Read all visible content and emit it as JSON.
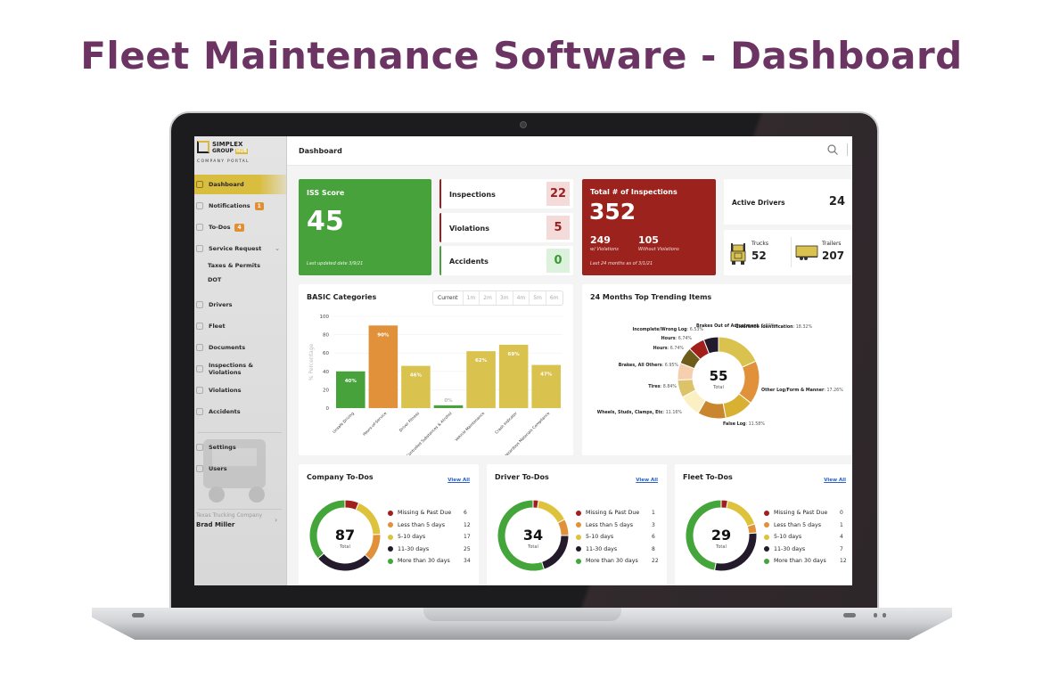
{
  "headline": "Fleet Maintenance Software - Dashboard",
  "sidebar": {
    "logo": {
      "line1": "SIMPLEX",
      "line2": "GROUP",
      "line2_tag": "HUB",
      "subtitle": "COMPANY PORTAL"
    },
    "items": [
      {
        "label": "Dashboard",
        "icon": "grid-icon",
        "active": true
      },
      {
        "label": "Notifications",
        "icon": "megaphone-icon",
        "badge": "1"
      },
      {
        "label": "To-Dos",
        "icon": "clipboard-icon",
        "badge": "4"
      },
      {
        "label": "Service Request",
        "icon": "briefcase-icon",
        "expandable": true
      },
      {
        "label": "Taxes & Permits",
        "sub": true
      },
      {
        "label": "DOT",
        "sub": true
      },
      {
        "label": "Drivers",
        "icon": "user-circle-icon"
      },
      {
        "label": "Fleet",
        "icon": "truck-icon"
      },
      {
        "label": "Documents",
        "icon": "document-icon"
      },
      {
        "label": "Inspections & Violations",
        "icon": "document-icon"
      },
      {
        "label": "Violations",
        "icon": "document-icon"
      },
      {
        "label": "Accidents",
        "icon": "document-icon"
      },
      {
        "label": "Settings",
        "icon": "gear-icon"
      },
      {
        "label": "Users",
        "icon": "users-icon"
      }
    ],
    "company": "Texas Trucking Company",
    "user": "Brad Miller"
  },
  "header": {
    "title": "Dashboard"
  },
  "iss": {
    "label": "ISS Score",
    "value": "45",
    "updated": "Last updated date 3/9/21",
    "color": "#48a23c"
  },
  "stats": [
    {
      "label": "Inspections",
      "value": "22",
      "status": "bad"
    },
    {
      "label": "Violations",
      "value": "5",
      "status": "bad"
    },
    {
      "label": "Accidents",
      "value": "0",
      "status": "good"
    }
  ],
  "total_inspections": {
    "label": "Total # of Inspections",
    "value": "352",
    "with_violations": "249",
    "with_violations_label": "w/ Violations",
    "without_violations": "105",
    "without_violations_label": "Without Violations",
    "period": "Last 24 months as of 3/1/21",
    "color": "#9c231d"
  },
  "active_drivers": {
    "label": "Active Drivers",
    "value": "24"
  },
  "vehicles": {
    "trucks_label": "Trucks",
    "trucks": "52",
    "trailers_label": "Trailers",
    "trailers": "207"
  },
  "basic": {
    "title": "BASIC Categories",
    "ranges": [
      "Current",
      "1m",
      "2m",
      "3m",
      "4m",
      "5m",
      "6m"
    ],
    "selected_range": "Current"
  },
  "trend": {
    "title": "24 Months Top Trending Items"
  },
  "todos": [
    {
      "title": "Company To-Dos",
      "view_all": "View All",
      "total": "87",
      "total_label": "Total",
      "items": [
        {
          "label": "Missing & Past Due",
          "count": 6
        },
        {
          "label": "Less than 5 days",
          "count": 12
        },
        {
          "label": "5-10 days",
          "count": 17
        },
        {
          "label": "11-30 days",
          "count": 25
        },
        {
          "label": "More than 30 days",
          "count": 34
        }
      ]
    },
    {
      "title": "Driver To-Dos",
      "view_all": "View All",
      "total": "34",
      "total_label": "Total",
      "items": [
        {
          "label": "Missing & Past Due",
          "count": 1
        },
        {
          "label": "Less than 5 days",
          "count": 3
        },
        {
          "label": "5-10 days",
          "count": 6
        },
        {
          "label": "11-30 days",
          "count": 8
        },
        {
          "label": "More than 30 days",
          "count": 22
        }
      ]
    },
    {
      "title": "Fleet To-Dos",
      "view_all": "View All",
      "total": "29",
      "total_label": "Total",
      "items": [
        {
          "label": "Missing & Past Due",
          "count": 0
        },
        {
          "label": "Less than 5 days",
          "count": 1
        },
        {
          "label": "5-10 days",
          "count": 4
        },
        {
          "label": "11-30 days",
          "count": 7
        },
        {
          "label": "More than 30 days",
          "count": 12
        }
      ]
    }
  ],
  "todo_colors": [
    "#a1201c",
    "#e0913a",
    "#dfc23c",
    "#231a2b",
    "#43a53a"
  ],
  "chart_data": [
    {
      "type": "bar",
      "title": "BASIC Categories",
      "ylabel": "% Percentage",
      "xlabel": "",
      "ylim": [
        0,
        100
      ],
      "yticks": [
        0,
        20,
        40,
        60,
        80,
        100
      ],
      "grid": true,
      "categories": [
        "Unsafe Driving",
        "Hours-of-Service",
        "Driver Fitness",
        "Controlled Substances & Alcohol",
        "Vehicle Maintenance",
        "Crash Indicator",
        "Hazardous Materials Compliance"
      ],
      "values": [
        40,
        90,
        46,
        0,
        62,
        69,
        47
      ],
      "labels": [
        "40%",
        "90%",
        "46%",
        "0%",
        "62%",
        "69%",
        "47%"
      ],
      "colors": [
        "#48a23c",
        "#e0913a",
        "#d9c24e",
        "#48a23c",
        "#d9c24e",
        "#d9c24e",
        "#d9c24e"
      ]
    },
    {
      "type": "pie",
      "donut": true,
      "title": "24 Months Top Trending Items",
      "center_value": "55",
      "center_label": "Total",
      "slices": [
        {
          "label": "Clearance Identification",
          "value": 18.32,
          "color": "#d9c24e"
        },
        {
          "label": "Other Log/Form & Manner",
          "value": 17.26,
          "color": "#e0913a"
        },
        {
          "label": "False Log",
          "value": 11.58,
          "color": "#d8b032"
        },
        {
          "label": "Wheels, Studs, Clamps, Etc",
          "value": 11.16,
          "color": "#c9862e"
        },
        {
          "label": "Tires",
          "value": 8.84,
          "color": "#fbf0c4"
        },
        {
          "label": "Brakes, All Others",
          "value": 6.95,
          "color": "#dcc36a"
        },
        {
          "label": "Hours",
          "value": 6.74,
          "color": "#f6cfae"
        },
        {
          "label": "Hours",
          "value": 6.74,
          "color": "#6e5c1a"
        },
        {
          "label": "Incomplete/Wrong Log",
          "value": 6.53,
          "color": "#a1201c"
        },
        {
          "label": "Brakes Out of Adjustment",
          "value": 5.89,
          "color": "#231a2b"
        }
      ]
    }
  ]
}
